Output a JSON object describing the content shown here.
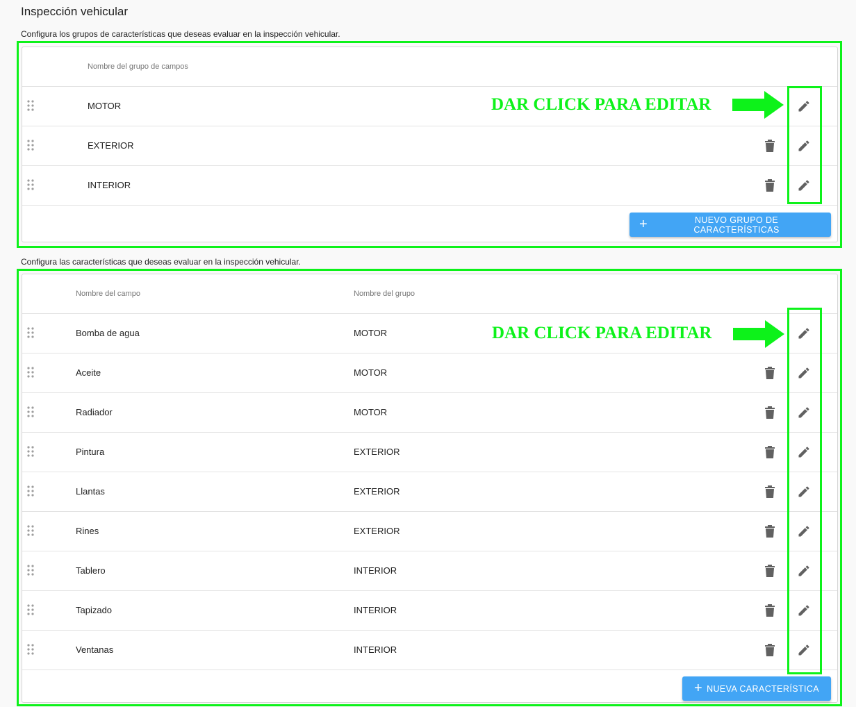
{
  "page": {
    "title": "Inspección vehicular"
  },
  "groups_section": {
    "description": "Configura los grupos de características que deseas evaluar en la inspección vehicular.",
    "header": {
      "name_col": "Nombre del grupo de campos"
    },
    "rows": [
      {
        "name": "MOTOR",
        "deletable": false
      },
      {
        "name": "EXTERIOR",
        "deletable": true
      },
      {
        "name": "INTERIOR",
        "deletable": true
      }
    ],
    "add_button": "NUEVO GRUPO DE CARACTERÍSTICAS"
  },
  "fields_section": {
    "description": "Configura las características que deseas evaluar en la inspección vehicular.",
    "header": {
      "name_col": "Nombre del campo",
      "group_col": "Nombre del grupo"
    },
    "rows": [
      {
        "name": "Bomba de agua",
        "group": "MOTOR",
        "deletable": false
      },
      {
        "name": "Aceite",
        "group": "MOTOR",
        "deletable": true
      },
      {
        "name": "Radiador",
        "group": "MOTOR",
        "deletable": true
      },
      {
        "name": "Pintura",
        "group": "EXTERIOR",
        "deletable": true
      },
      {
        "name": "Llantas",
        "group": "EXTERIOR",
        "deletable": true
      },
      {
        "name": "Rines",
        "group": "EXTERIOR",
        "deletable": true
      },
      {
        "name": "Tablero",
        "group": "INTERIOR",
        "deletable": true
      },
      {
        "name": "Tapizado",
        "group": "INTERIOR",
        "deletable": true
      },
      {
        "name": "Ventanas",
        "group": "INTERIOR",
        "deletable": true
      }
    ],
    "add_button": "NUEVA CARACTERÍSTICA"
  },
  "annotations": {
    "groups_hint": "DAR CLICK PARA EDITAR",
    "fields_hint": "DAR CLICK PARA EDITAR"
  },
  "colors": {
    "highlight": "#0df21a",
    "button": "#42a5f5",
    "icon": "#616161"
  },
  "icons": {
    "drag": "drag-handle-icon",
    "delete": "trash-icon",
    "edit": "pencil-icon",
    "add": "plus-icon"
  }
}
